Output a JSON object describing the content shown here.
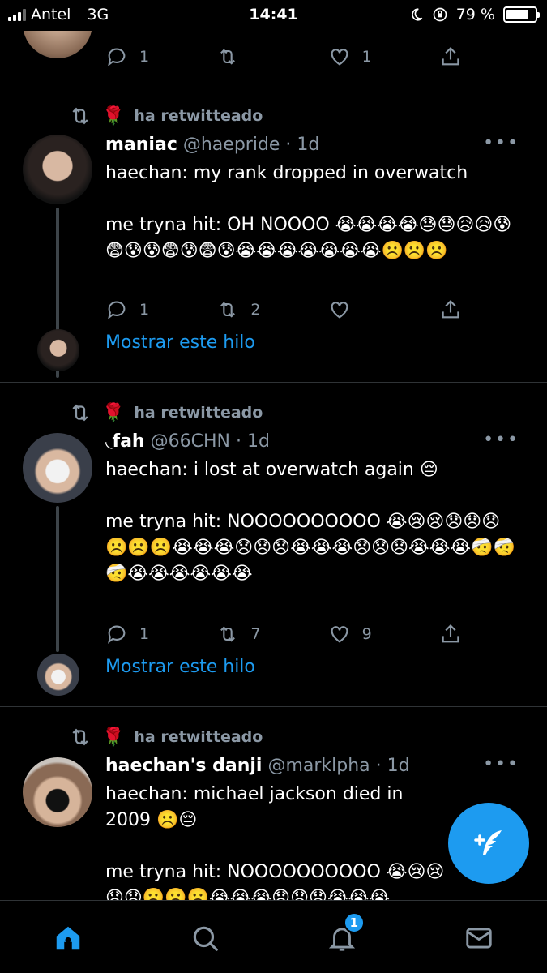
{
  "status_bar": {
    "carrier": "Antel",
    "network": "3G",
    "time": "14:41",
    "battery": "79 %",
    "battery_level": 0.79
  },
  "colors": {
    "accent": "#1d9bf0",
    "background": "#000000",
    "muted": "#8b98a5",
    "rose": "#d01f3c"
  },
  "partial_tweet": {
    "cut_text": "· · · · · · · · · · · ·",
    "replies": "1",
    "retweets": "",
    "likes": "1"
  },
  "tweets": [
    {
      "retweet_label": "ha retwitteado",
      "name": "maniac",
      "handle": "@haepride · 1d",
      "text": "haechan: my rank dropped in overwatch\n\nme tryna hit: OH NOOOO 😭😭😭😭😓😓😥😥😰😨😰😰😨😰😨😰😭😭😭😭😭😭😭☹️☹️☹️",
      "replies": "1",
      "retweets": "2",
      "likes": "",
      "show_thread": "Mostrar este hilo"
    },
    {
      "retweet_label": "ha retwitteado",
      "name": "◟fah",
      "handle": "@66CHN · 1d",
      "text": "haechan: i lost at overwatch again 😔\n\nme tryna hit: NOOOOOOOOOO 😭😢😢😞😞😞☹️☹️☹️😭😭😭😞😞😞😭😭😭😞😞😞😭😭😭🤕🤕🤕😭😭😭😭😭😭",
      "replies": "1",
      "retweets": "7",
      "likes": "9",
      "show_thread": "Mostrar este hilo"
    },
    {
      "retweet_label": "ha retwitteado",
      "name": "haechan's danji",
      "handle": "@marklpha · 1d",
      "text": "haechan: michael jackson died in 2009 ☹️😔\n\nme tryna hit: NOOOOOOOOOO 😭😢😢😞😞☹️☹️☹️😭😭😭😞😞😞😭😭😭"
    }
  ],
  "tabs": [
    {
      "icon": "home-icon",
      "active": true
    },
    {
      "icon": "search-icon",
      "active": false
    },
    {
      "icon": "bell-icon",
      "active": false,
      "badge": "1"
    },
    {
      "icon": "mail-icon",
      "active": false
    }
  ],
  "fab": {
    "icon": "compose-icon"
  }
}
